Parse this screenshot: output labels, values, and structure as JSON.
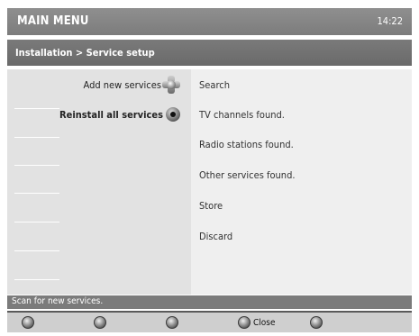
{
  "header": {
    "title": "MAIN MENU",
    "clock": "14:22"
  },
  "breadcrumb": "Installation > Service setup",
  "left_panel": {
    "options": [
      {
        "label": "Add new services",
        "icon": "dpad-icon",
        "selected": false
      },
      {
        "label": "Reinstall all services",
        "icon": "radio-icon",
        "selected": true
      }
    ]
  },
  "right_panel": {
    "items": [
      "Search",
      "TV channels found.",
      "Radio stations found.",
      "Other services found.",
      "Store",
      "Discard"
    ]
  },
  "status": "Scan for new services.",
  "keys": [
    {
      "label": ""
    },
    {
      "label": ""
    },
    {
      "label": ""
    },
    {
      "label": "Close"
    },
    {
      "label": ""
    }
  ],
  "colors": {
    "title_bar": "#858585",
    "breadcrumb_bar": "#727272",
    "left_panel": "#e2e2e2",
    "right_panel": "#efefef",
    "status_bar": "#7b7b7b"
  }
}
